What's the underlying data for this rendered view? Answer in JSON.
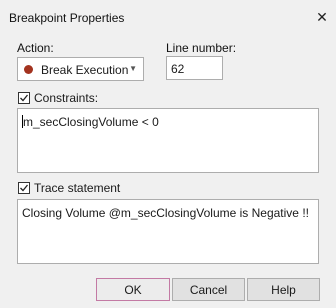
{
  "window": {
    "title": "Breakpoint Properties"
  },
  "action": {
    "label": "Action:",
    "selected": "Break Execution",
    "dot_color": "#a3331f"
  },
  "line_number": {
    "label": "Line number:",
    "value": "62"
  },
  "constraints": {
    "label": "Constraints:",
    "checked": true,
    "value": "m_secClosingVolume < 0"
  },
  "trace": {
    "label": "Trace statement",
    "checked": true,
    "value": "Closing Volume @m_secClosingVolume is Negative !!"
  },
  "buttons": {
    "ok": "OK",
    "cancel": "Cancel",
    "help": "Help"
  }
}
